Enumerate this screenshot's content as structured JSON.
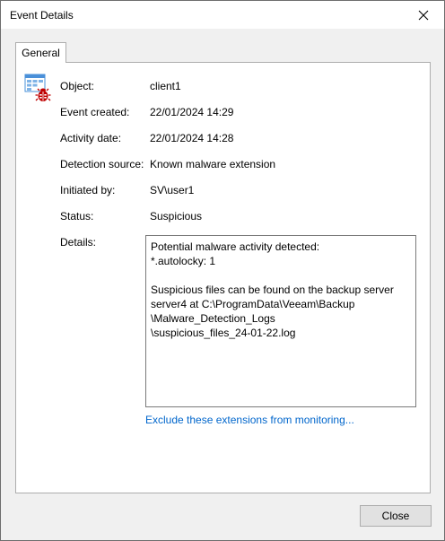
{
  "window": {
    "title": "Event Details",
    "close_icon": "close-x-icon"
  },
  "tabs": [
    {
      "label": "General",
      "selected": true
    }
  ],
  "fields": {
    "object": {
      "label": "Object:",
      "value": "client1"
    },
    "event_created": {
      "label": "Event created:",
      "value": "22/01/2024 14:29"
    },
    "activity_date": {
      "label": "Activity date:",
      "value": "22/01/2024 14:28"
    },
    "detection_source": {
      "label": "Detection source:",
      "value": "Known malware extension"
    },
    "initiated_by": {
      "label": "Initiated by:",
      "value": "SV\\user1"
    },
    "status": {
      "label": "Status:",
      "value": "Suspicious"
    },
    "details": {
      "label": "Details:",
      "value": "Potential malware activity detected:\n*.autolocky: 1\n\nSuspicious files can be found on the backup server\nserver4 at C:\\ProgramData\\Veeam\\Backup\n\\Malware_Detection_Logs\n\\suspicious_files_24-01-22.log"
    }
  },
  "link": {
    "label": "Exclude these extensions from monitoring..."
  },
  "buttons": {
    "close_label": "Close"
  },
  "colors": {
    "link": "#0066cc",
    "icon_grid": "#4a90d9",
    "icon_bug": "#c00000"
  }
}
